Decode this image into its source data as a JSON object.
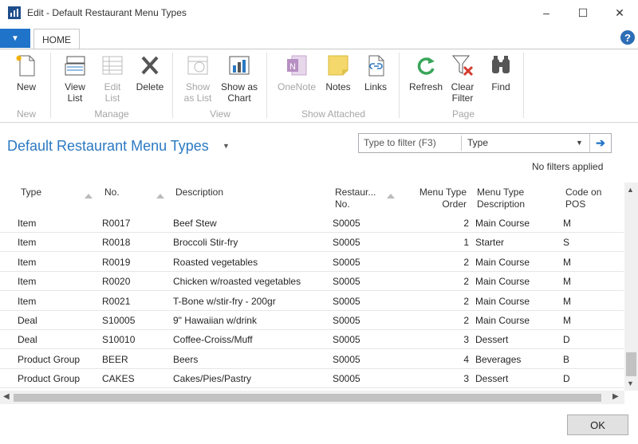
{
  "window": {
    "title": "Edit - Default Restaurant Menu Types",
    "minimize": "–",
    "maximize": "☐",
    "close": "✕"
  },
  "ribbon": {
    "tab": "HOME",
    "buttons": {
      "new": "New",
      "view_list": "View\nList",
      "edit_list": "Edit\nList",
      "delete": "Delete",
      "show_as_list": "Show\nas List",
      "show_as_chart": "Show as\nChart",
      "onenote": "OneNote",
      "notes": "Notes",
      "links": "Links",
      "refresh": "Refresh",
      "clear_filter": "Clear\nFilter",
      "find": "Find"
    },
    "groups": {
      "new": "New",
      "manage": "Manage",
      "view": "View",
      "show_attached": "Show Attached",
      "page": "Page"
    }
  },
  "page": {
    "title": "Default Restaurant Menu Types",
    "filter_placeholder": "Type to filter (F3)",
    "filter_field": "Type",
    "no_filters": "No filters applied"
  },
  "table": {
    "headers": {
      "type": "Type",
      "no": "No.",
      "description": "Description",
      "restaurant_no": "Restaur...\nNo.",
      "menu_type_order": "Menu Type\nOrder",
      "menu_type_description": "Menu Type\nDescription",
      "code_on_pos": "Code on\nPOS"
    },
    "rows": [
      {
        "type": "Item",
        "no": "R0017",
        "description": "Beef Stew",
        "restaurant_no": "S0005",
        "order": "2",
        "menu_desc": "Main Course",
        "code": "M"
      },
      {
        "type": "Item",
        "no": "R0018",
        "description": "Broccoli Stir-fry",
        "restaurant_no": "S0005",
        "order": "1",
        "menu_desc": "Starter",
        "code": "S"
      },
      {
        "type": "Item",
        "no": "R0019",
        "description": "Roasted vegetables",
        "restaurant_no": "S0005",
        "order": "2",
        "menu_desc": "Main Course",
        "code": "M"
      },
      {
        "type": "Item",
        "no": "R0020",
        "description": "Chicken w/roasted vegetables",
        "restaurant_no": "S0005",
        "order": "2",
        "menu_desc": "Main Course",
        "code": "M"
      },
      {
        "type": "Item",
        "no": "R0021",
        "description": "T-Bone w/stir-fry - 200gr",
        "restaurant_no": "S0005",
        "order": "2",
        "menu_desc": "Main Course",
        "code": "M"
      },
      {
        "type": "Deal",
        "no": "S10005",
        "description": "9\" Hawaiian w/drink",
        "restaurant_no": "S0005",
        "order": "2",
        "menu_desc": "Main Course",
        "code": "M"
      },
      {
        "type": "Deal",
        "no": "S10010",
        "description": "Coffee-Croiss/Muff",
        "restaurant_no": "S0005",
        "order": "3",
        "menu_desc": "Dessert",
        "code": "D"
      },
      {
        "type": "Product Group",
        "no": "BEER",
        "description": "Beers",
        "restaurant_no": "S0005",
        "order": "4",
        "menu_desc": "Beverages",
        "code": "B"
      },
      {
        "type": "Product Group",
        "no": "CAKES",
        "description": "Cakes/Pies/Pastry",
        "restaurant_no": "S0005",
        "order": "3",
        "menu_desc": "Dessert",
        "code": "D"
      }
    ]
  },
  "footer": {
    "ok": "OK"
  },
  "colors": {
    "accent": "#1f73c8",
    "title_blue": "#2b79c2"
  }
}
